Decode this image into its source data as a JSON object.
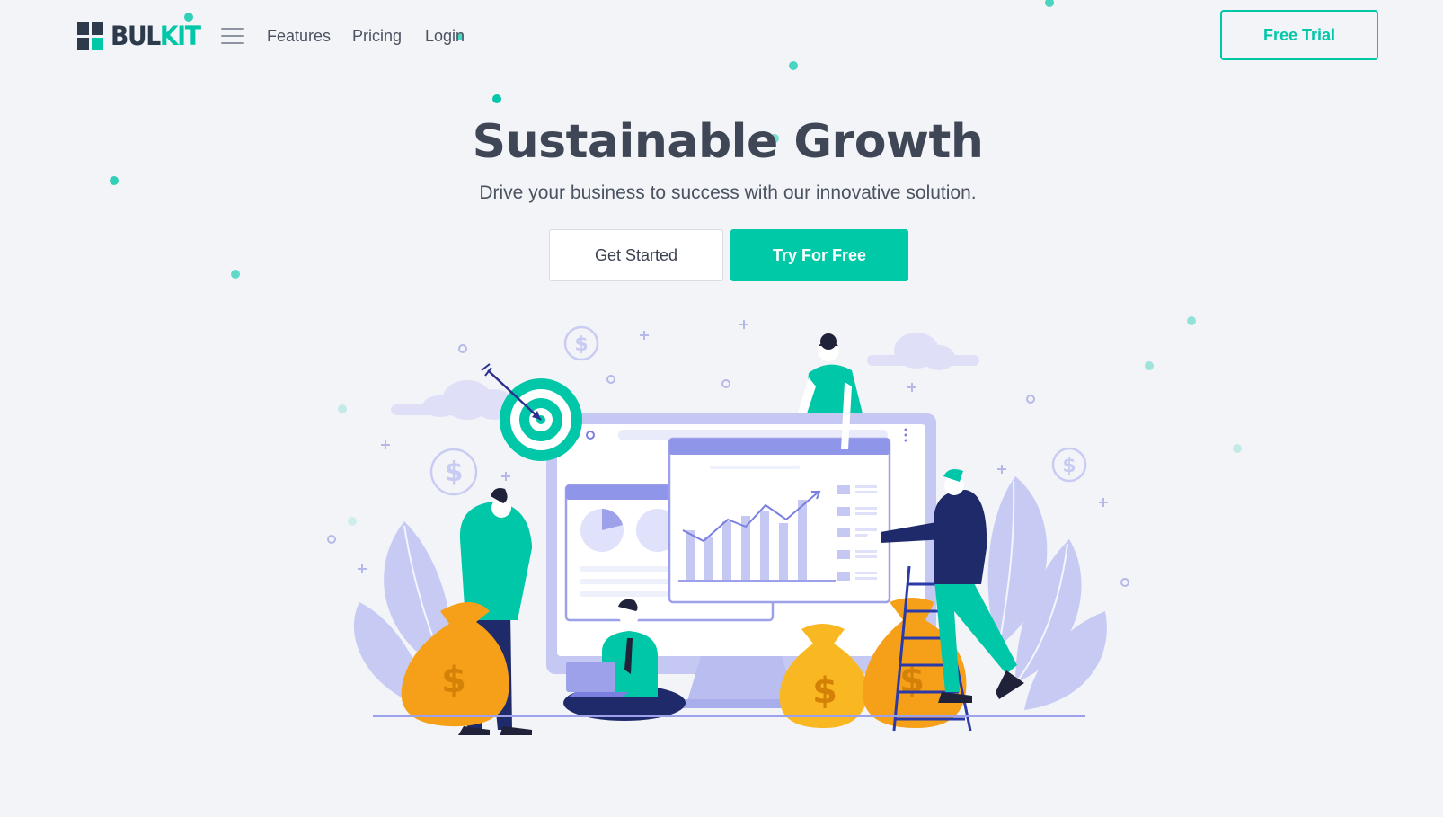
{
  "brand": {
    "name_part1": "BUL",
    "name_part2": "KIT",
    "colors": {
      "accent": "#00c7a8",
      "dark": "#2d3a4b",
      "background": "#f3f4f8"
    }
  },
  "nav": {
    "menu_icon": "hamburger-menu-icon",
    "links": [
      {
        "label": "Features"
      },
      {
        "label": "Pricing"
      },
      {
        "label": "Login"
      }
    ],
    "cta_label": "Free Trial"
  },
  "hero": {
    "title": "Sustainable Growth",
    "subtitle": "Drive your business to success with our innovative solution.",
    "primary_button": "Get Started",
    "secondary_button": "Try For Free",
    "illustration": "business-growth-illustration"
  }
}
